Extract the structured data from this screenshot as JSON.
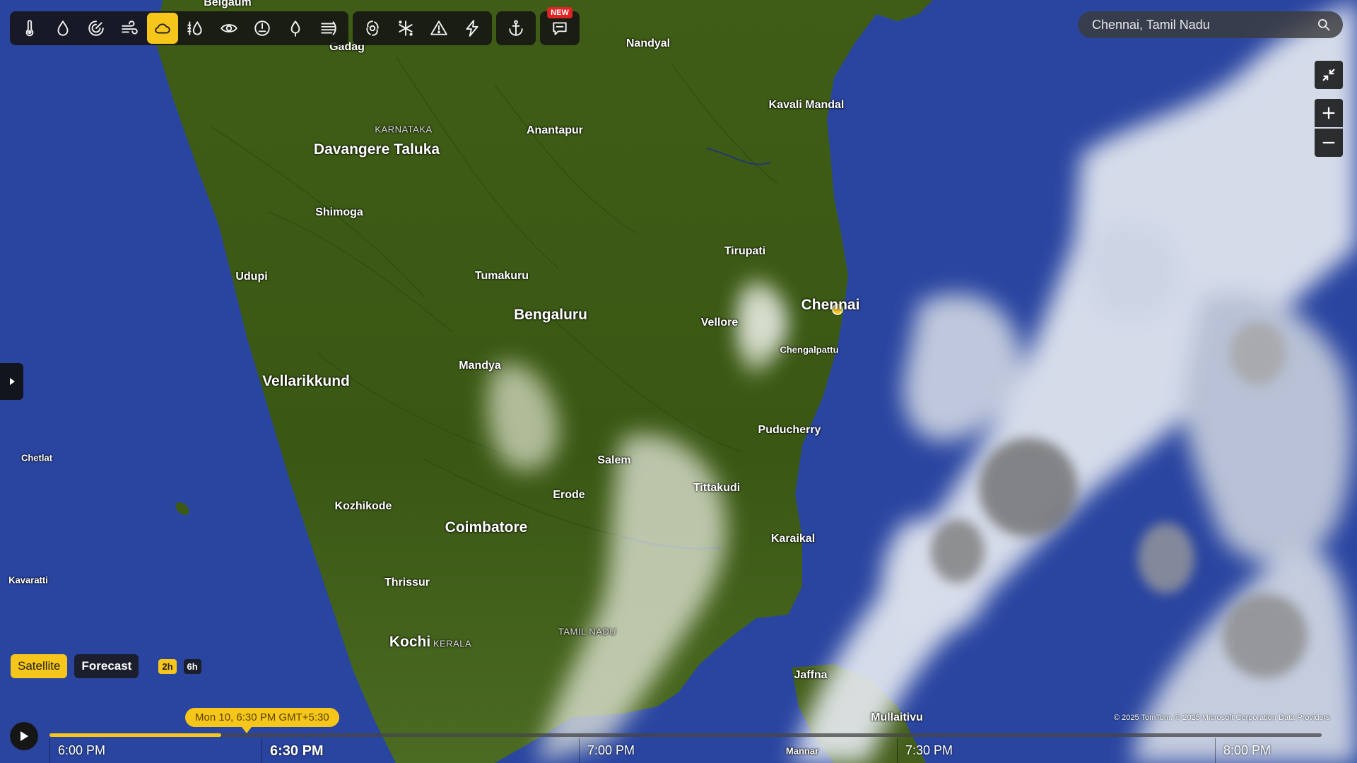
{
  "toolbar": {
    "groups": [
      [
        {
          "name": "temperature-icon",
          "active": false
        },
        {
          "name": "precipitation-icon",
          "active": false
        },
        {
          "name": "radar-icon",
          "active": false
        },
        {
          "name": "wind-icon",
          "active": false
        },
        {
          "name": "cloud-icon",
          "active": true
        },
        {
          "name": "humidity-icon",
          "active": false
        },
        {
          "name": "visibility-icon",
          "active": false
        },
        {
          "name": "pressure-icon",
          "active": false
        },
        {
          "name": "dew-point-icon",
          "active": false
        },
        {
          "name": "air-quality-icon",
          "active": false
        }
      ],
      [
        {
          "name": "hurricane-icon",
          "active": false
        },
        {
          "name": "snow-icon",
          "active": false
        },
        {
          "name": "alert-icon",
          "active": false
        },
        {
          "name": "lightning-icon",
          "active": false
        }
      ],
      [
        {
          "name": "anchor-icon",
          "active": false
        }
      ],
      [
        {
          "name": "feedback-icon",
          "active": false
        }
      ]
    ],
    "new_badge": "NEW"
  },
  "search": {
    "value": "Chennai, Tamil Nadu"
  },
  "map_controls": [
    "collapse-icon",
    "zoom-in-icon",
    "zoom-out-icon"
  ],
  "map": {
    "colors": {
      "ocean": "#2a45a0",
      "land": "#3a5a15",
      "land_light": "#4f6e22",
      "marker": "#f7c61a"
    },
    "place_labels": [
      {
        "text": "Belgaum",
        "size": "s"
      },
      {
        "text": "Gadag",
        "size": "s"
      },
      {
        "text": "Nandyal",
        "size": "s"
      },
      {
        "text": "KARNATAKA",
        "size": "reg"
      },
      {
        "text": "Davangere Taluka",
        "size": "l"
      },
      {
        "text": "Anantapur",
        "size": "s"
      },
      {
        "text": "Kavali Mandal",
        "size": "s"
      },
      {
        "text": "Shimoga",
        "size": "s"
      },
      {
        "text": "Tirupati",
        "size": "s"
      },
      {
        "text": "Udupi",
        "size": "s"
      },
      {
        "text": "Tumakuru",
        "size": "s"
      },
      {
        "text": "Chennai",
        "size": "l"
      },
      {
        "text": "Bengaluru",
        "size": "l"
      },
      {
        "text": "Vellore",
        "size": "s"
      },
      {
        "text": "Chengalpattu",
        "size": "xs"
      },
      {
        "text": "Mandya",
        "size": "s"
      },
      {
        "text": "Vellarikkund",
        "size": "l"
      },
      {
        "text": "Puducherry",
        "size": "s"
      },
      {
        "text": "Chetlat",
        "size": "xs"
      },
      {
        "text": "Salem",
        "size": "s"
      },
      {
        "text": "Tittakudi",
        "size": "s"
      },
      {
        "text": "Erode",
        "size": "s"
      },
      {
        "text": "Kozhikode",
        "size": "s"
      },
      {
        "text": "Coimbatore",
        "size": "l"
      },
      {
        "text": "Karaikal",
        "size": "s"
      },
      {
        "text": "Kavaratti",
        "size": "xs"
      },
      {
        "text": "Thrissur",
        "size": "s"
      },
      {
        "text": "TAMIL NADU",
        "size": "reg"
      },
      {
        "text": "Kochi",
        "size": "l"
      },
      {
        "text": "KERALA",
        "size": "reg"
      },
      {
        "text": "Jaffna",
        "size": "s"
      },
      {
        "text": "Mullaitivu",
        "size": "s"
      },
      {
        "text": "Mannar",
        "size": "xs"
      }
    ]
  },
  "modes": {
    "satellite": "Satellite",
    "forecast": "Forecast",
    "range_2h": "2h",
    "range_6h": "6h"
  },
  "timeline": {
    "current_bubble": "Mon 10, 6:30 PM GMT+5:30",
    "progress": 0.135,
    "labels": [
      "6:00 PM",
      "6:30 PM",
      "7:00 PM",
      "7:30 PM",
      "8:00 PM"
    ],
    "current_index": 1
  },
  "attribution": "© 2025 TomTom, © 2025 Microsoft Corporation  Data Providers"
}
